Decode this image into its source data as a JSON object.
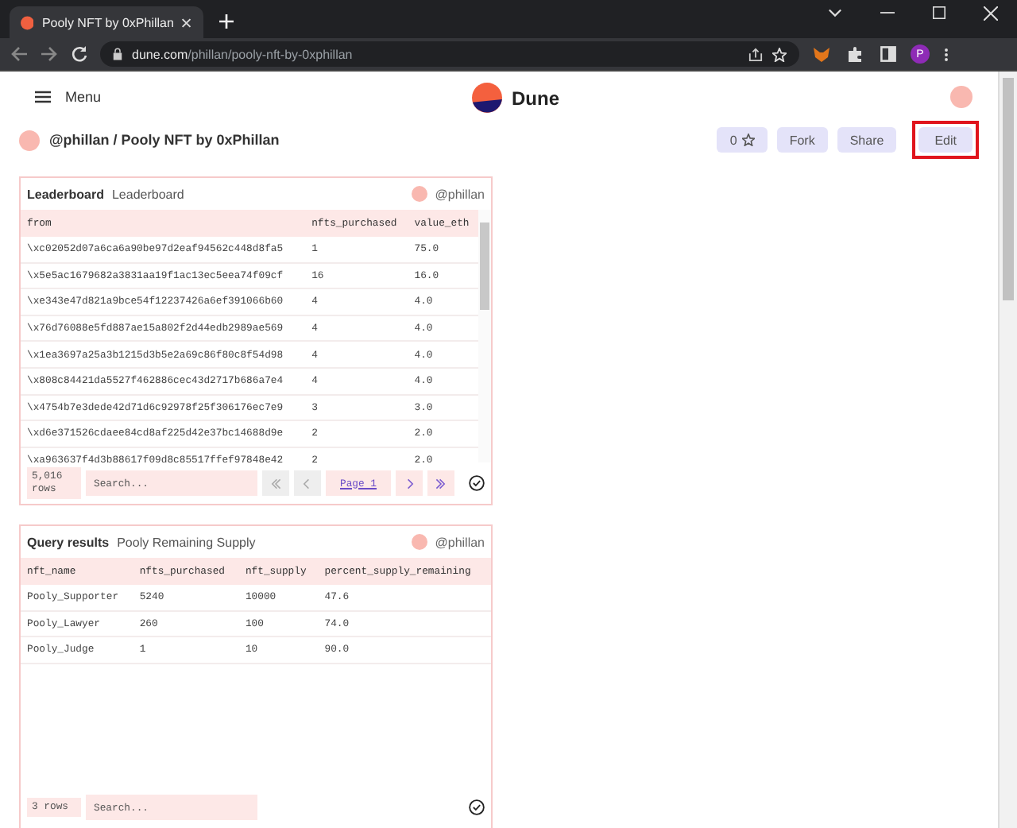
{
  "browser": {
    "tab_title": "Pooly NFT by 0xPhillan",
    "url_domain": "dune.com",
    "url_path": "/phillan/pooly-nft-by-0xphillan",
    "profile_letter": "P"
  },
  "header": {
    "menu_label": "Menu",
    "logo_text": "Dune"
  },
  "dashboard": {
    "breadcrumb": "@phillan / Pooly NFT by 0xPhillan",
    "buttons": [
      {
        "kind": "star",
        "label": "0",
        "highlighted": false
      },
      {
        "kind": "text",
        "label": "Fork",
        "highlighted": false
      },
      {
        "kind": "text",
        "label": "Share",
        "highlighted": false
      },
      {
        "kind": "text",
        "label": "Edit",
        "highlighted": true
      }
    ]
  },
  "cards": [
    {
      "title": "Leaderboard",
      "subtitle": "Leaderboard",
      "author": "@phillan",
      "columns": [
        "from",
        "nfts_purchased",
        "value_eth"
      ],
      "rows": [
        [
          "\\xc02052d07a6ca6a90be97d2eaf94562c448d8fa5",
          "1",
          "75.0"
        ],
        [
          "\\x5e5ac1679682a3831aa19f1ac13ec5eea74f09cf",
          "16",
          "16.0"
        ],
        [
          "\\xe343e47d821a9bce54f12237426a6ef391066b60",
          "4",
          "4.0"
        ],
        [
          "\\x76d76088e5fd887ae15a802f2d44edb2989ae569",
          "4",
          "4.0"
        ],
        [
          "\\x1ea3697a25a3b1215d3b5e2a69c86f80c8f54d98",
          "4",
          "4.0"
        ],
        [
          "\\x808c84421da5527f462886cec43d2717b686a7e4",
          "4",
          "4.0"
        ],
        [
          "\\x4754b7e3dede42d71d6c92978f25f306176ec7e9",
          "3",
          "3.0"
        ],
        [
          "\\xd6e371526cdaee84cd8af225d42e37bc14688d9e",
          "2",
          "2.0"
        ],
        [
          "\\xa963637f4d3b88617f09d8c85517ffef97848e42",
          "2",
          "2.0"
        ]
      ],
      "row_count": "5,016 rows",
      "search_placeholder": "Search...",
      "page_label": "Page 1",
      "scrollable": true
    },
    {
      "title": "Query results",
      "subtitle": "Pooly Remaining Supply",
      "author": "@phillan",
      "columns": [
        "nft_name",
        "nfts_purchased",
        "nft_supply",
        "percent_supply_remaining"
      ],
      "rows": [
        [
          "Pooly_Supporter",
          "5240",
          "10000",
          "47.6"
        ],
        [
          "Pooly_Lawyer",
          "260",
          "100",
          "74.0"
        ],
        [
          "Pooly_Judge",
          "1",
          "10",
          "90.0"
        ]
      ],
      "row_count": "3 rows",
      "search_placeholder": "Search...",
      "scrollable": false
    }
  ]
}
